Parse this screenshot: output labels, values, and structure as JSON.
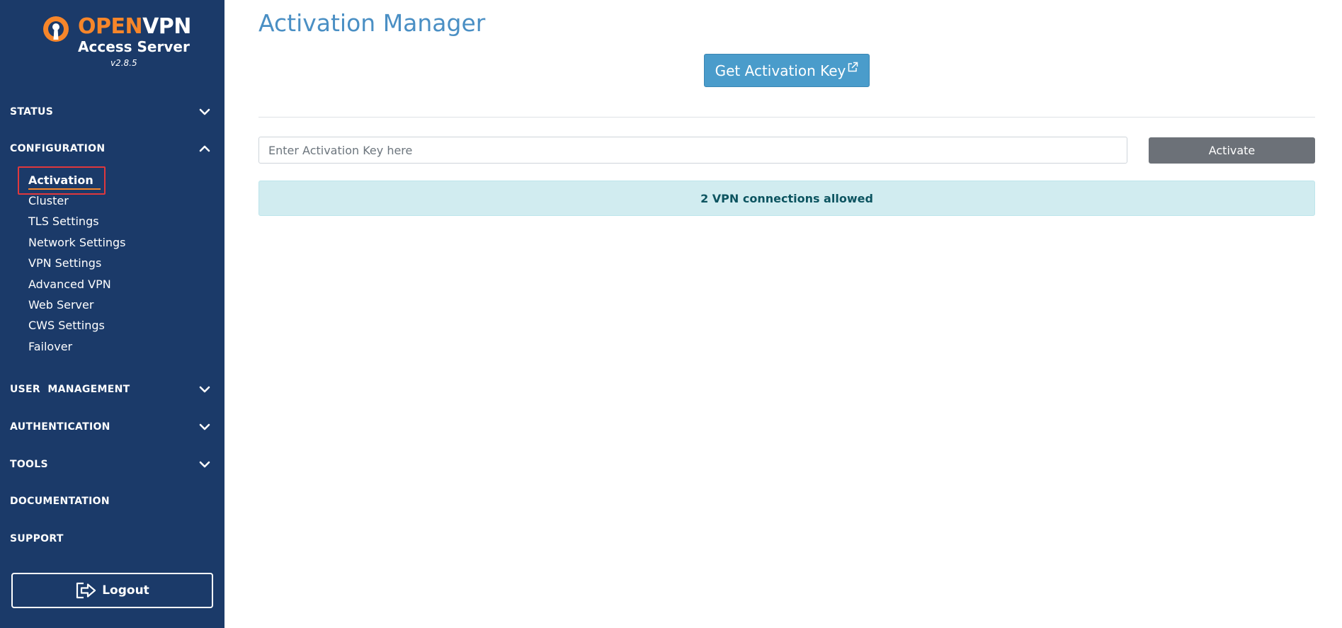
{
  "brand": {
    "name_part1": "OPEN",
    "name_part2": "VPN",
    "product": "Access Server",
    "version": "v2.8.5",
    "accent_color": "#f7862a",
    "sidebar_color": "#1b3a69"
  },
  "sidebar": {
    "sections": [
      {
        "label": "STATUS",
        "icon": "chevron-down-icon"
      },
      {
        "label": "CONFIGURATION",
        "icon": "chevron-up-icon"
      },
      {
        "label": "USER  MANAGEMENT",
        "icon": "chevron-down-icon"
      },
      {
        "label": "AUTHENTICATION",
        "icon": "chevron-down-icon"
      },
      {
        "label": "TOOLS",
        "icon": "chevron-down-icon"
      },
      {
        "label": "DOCUMENTATION"
      },
      {
        "label": "SUPPORT"
      }
    ],
    "configuration_items": [
      {
        "label": "Activation",
        "active": true
      },
      {
        "label": "Cluster"
      },
      {
        "label": "TLS Settings"
      },
      {
        "label": "Network Settings"
      },
      {
        "label": "VPN Settings"
      },
      {
        "label": "Advanced VPN"
      },
      {
        "label": "Web Server"
      },
      {
        "label": "CWS Settings"
      },
      {
        "label": "Failover"
      }
    ],
    "logout_label": "Logout",
    "logout_icon": "logout-icon"
  },
  "main": {
    "title": "Activation Manager",
    "get_key_label": "Get Activation Key",
    "get_key_icon": "external-link-icon",
    "input_placeholder": "Enter Activation Key here",
    "input_value": "",
    "activate_label": "Activate",
    "alert_text": "2 VPN connections allowed"
  }
}
